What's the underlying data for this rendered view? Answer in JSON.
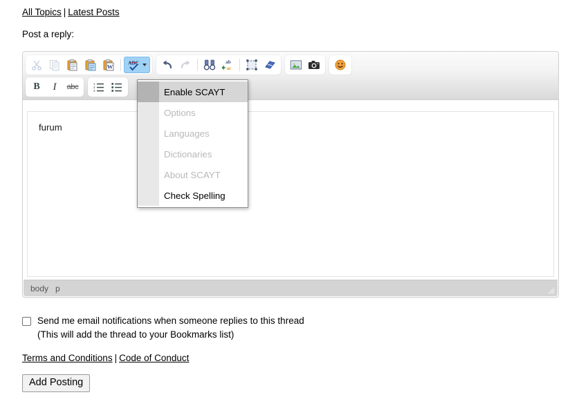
{
  "topnav": {
    "all_topics": "All Topics",
    "separator": "|",
    "latest_posts": "Latest Posts"
  },
  "post_label": "Post a reply:",
  "editor": {
    "content": "furum",
    "statusbar": {
      "path": [
        "body",
        "p"
      ]
    },
    "toolbar_row1": [
      {
        "name": "cut-icon",
        "title": "Cut",
        "state": "disabled"
      },
      {
        "name": "copy-icon",
        "title": "Copy",
        "state": "disabled"
      },
      {
        "name": "paste-icon",
        "title": "Paste",
        "state": "normal"
      },
      {
        "name": "paste-text-icon",
        "title": "Paste as plain text",
        "state": "normal"
      },
      {
        "name": "paste-word-icon",
        "title": "Paste from Word",
        "state": "normal"
      },
      {
        "name": "spellcheck-scayt-icon",
        "title": "Spell Check As You Type",
        "state": "active"
      },
      {
        "name": "undo-icon",
        "title": "Undo",
        "state": "normal"
      },
      {
        "name": "redo-icon",
        "title": "Redo",
        "state": "disabled"
      },
      {
        "name": "find-icon",
        "title": "Find",
        "state": "normal"
      },
      {
        "name": "replace-icon",
        "title": "Replace",
        "state": "normal"
      },
      {
        "name": "select-all-icon",
        "title": "Select All",
        "state": "normal"
      },
      {
        "name": "remove-format-icon",
        "title": "Remove Format",
        "state": "normal"
      },
      {
        "name": "image-icon",
        "title": "Image",
        "state": "normal"
      },
      {
        "name": "camera-icon",
        "title": "Camera",
        "state": "normal"
      },
      {
        "name": "smiley-icon",
        "title": "Smiley",
        "state": "normal"
      }
    ],
    "toolbar_row2": [
      {
        "name": "bold-button",
        "label": "B",
        "title": "Bold"
      },
      {
        "name": "italic-button",
        "label": "I",
        "title": "Italic"
      },
      {
        "name": "strikethrough-button",
        "label": "abc",
        "title": "Strike Through"
      },
      {
        "name": "numbered-list-button",
        "label": "",
        "title": "Insert/Remove Numbered List"
      },
      {
        "name": "bulleted-list-button",
        "label": "",
        "title": "Insert/Remove Bulleted List"
      }
    ]
  },
  "scayt_menu": {
    "items": [
      {
        "label": "Enable SCAYT",
        "state": "hover"
      },
      {
        "label": "Options",
        "state": "disabled"
      },
      {
        "label": "Languages",
        "state": "disabled"
      },
      {
        "label": "Dictionaries",
        "state": "disabled"
      },
      {
        "label": "About SCAYT",
        "state": "disabled"
      },
      {
        "label": "Check Spelling",
        "state": "normal"
      }
    ]
  },
  "notify": {
    "label": "Send me email notifications when someone replies to this thread",
    "sublabel": "(This will add the thread to your Bookmarks list)",
    "checked": false
  },
  "legal": {
    "terms": "Terms and Conditions",
    "separator": "|",
    "conduct": "Code of Conduct"
  },
  "submit": {
    "label": "Add Posting"
  },
  "colors": {
    "accent_active": "#9fd2f5",
    "toolbar_bg": "#f3f3f3",
    "statusbar_bg": "#d4d4d4",
    "menu_border": "#8e8e8e"
  }
}
